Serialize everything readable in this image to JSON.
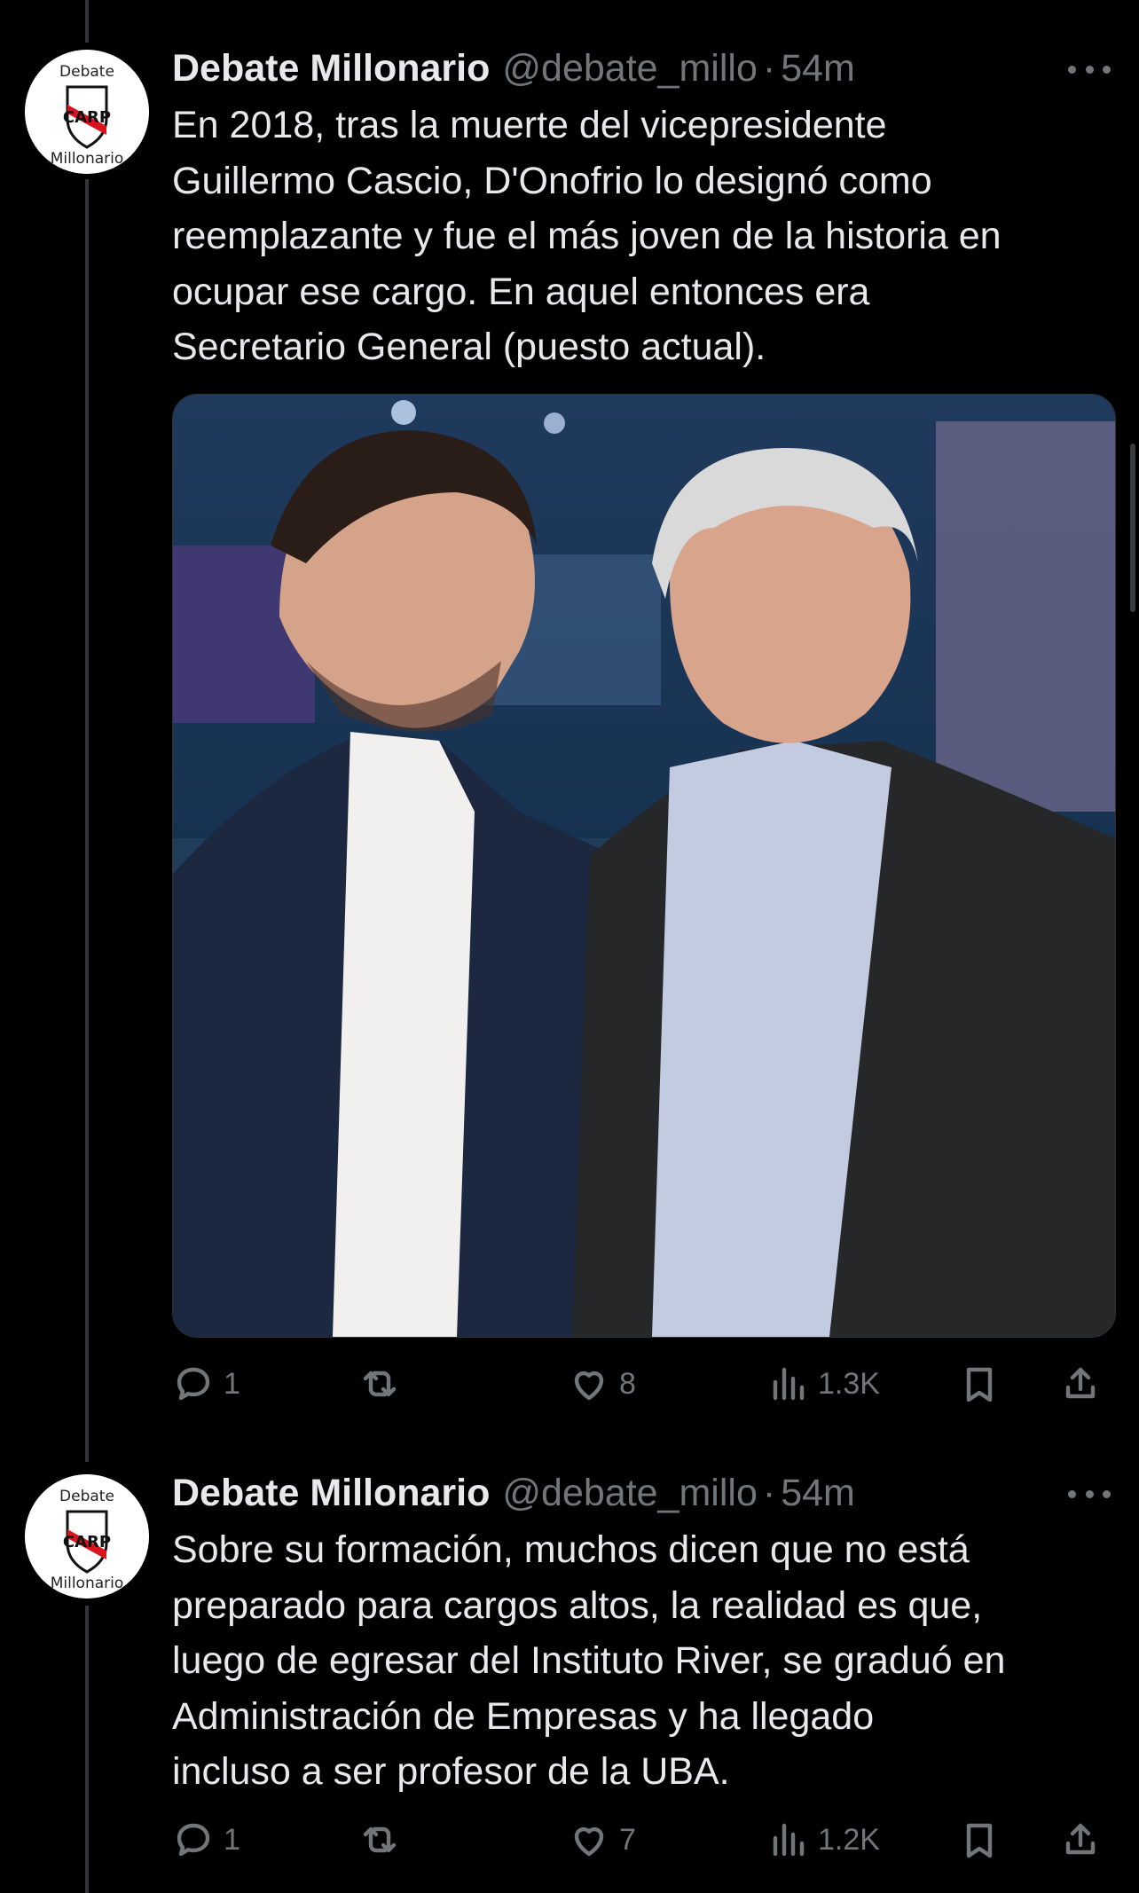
{
  "tweets": [
    {
      "name": "Debate Millonario",
      "handle": "@debate_millo",
      "separator": "·",
      "time": "54m",
      "avatar_logo_text": [
        "Debate",
        "Millonario"
      ],
      "text": "En 2018, tras la muerte del vicepresidente\nGuillermo Cascio, D'Onofrio lo designó como\nreemplazante y fue el más joven de la historia en\nocupar ese cargo. En aquel entonces era\nSecretario General (puesto actual).",
      "media": "photo-two-men-suits-tv-studio",
      "replies": "1",
      "retweets": "",
      "likes": "8",
      "views": "1.3K"
    },
    {
      "name": "Debate Millonario",
      "handle": "@debate_millo",
      "separator": "·",
      "time": "54m",
      "avatar_logo_text": [
        "Debate",
        "Millonario"
      ],
      "text": "Sobre su formación, muchos dicen que no está\npreparado para cargos altos, la realidad es que,\nluego de egresar del Instituto River, se graduó en\nAdministración de Empresas y ha llegado\nincluso a ser profesor de la UBA.",
      "replies": "1",
      "retweets": "",
      "likes": "7",
      "views": "1.2K"
    }
  ],
  "colors": {
    "background": "#000000",
    "text": "#e7e9ea",
    "muted": "#71767b",
    "line": "#333639",
    "brand_red": "#d7141f"
  },
  "icons": [
    "reply-icon",
    "retweet-icon",
    "like-icon",
    "views-icon",
    "bookmark-icon",
    "share-icon",
    "more-icon"
  ]
}
